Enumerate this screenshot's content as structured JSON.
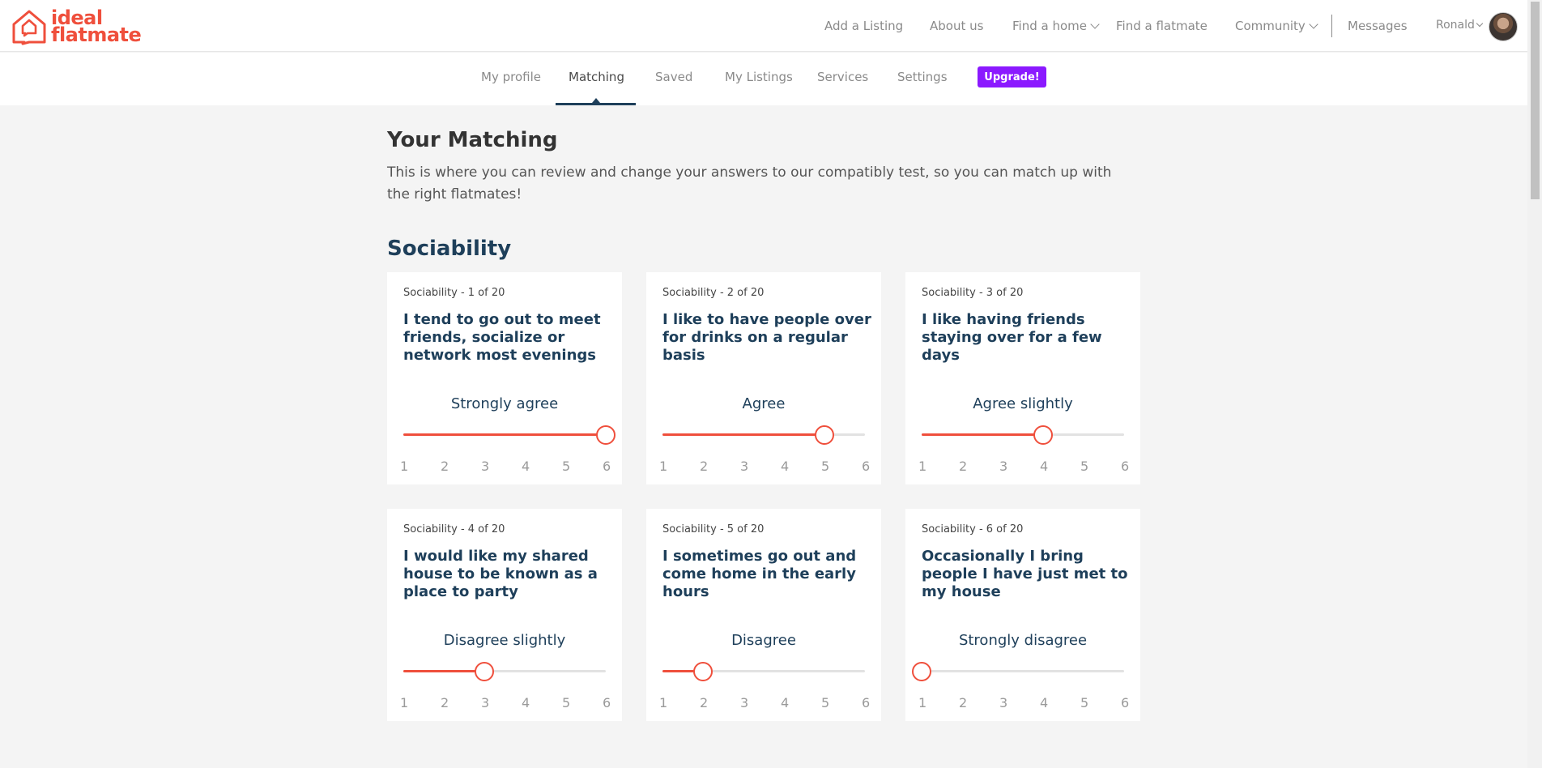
{
  "brand": {
    "line1": "ideal",
    "line2": "flatmate",
    "color": "#ef4f3c"
  },
  "topnav": {
    "add_listing": "Add a Listing",
    "about": "About us",
    "find_home": "Find a home",
    "find_flatmate": "Find a flatmate",
    "community": "Community",
    "messages": "Messages",
    "user": "Ronald"
  },
  "subnav": {
    "tabs": [
      "My profile",
      "Matching",
      "Saved",
      "My Listings",
      "Services",
      "Settings"
    ],
    "active": "Matching",
    "upgrade": "Upgrade!",
    "upgrade_color": "#8b19ff"
  },
  "page": {
    "title": "Your Matching",
    "intro": "This is where you can review and change your answers to our compatibly test, so you can match up with the right flatmates!"
  },
  "section": {
    "title": "Sociability"
  },
  "scale_labels": [
    "1",
    "2",
    "3",
    "4",
    "5",
    "6"
  ],
  "questions": [
    {
      "counter": "Sociability - 1 of 20",
      "text": "I tend to go out to meet friends, socialize or network most evenings",
      "answer": "Strongly agree",
      "value": 6
    },
    {
      "counter": "Sociability - 2 of 20",
      "text": "I like to have people over for drinks on a regular basis",
      "answer": "Agree",
      "value": 5
    },
    {
      "counter": "Sociability - 3 of 20",
      "text": "I like having friends staying over for a few days",
      "answer": "Agree slightly",
      "value": 4
    },
    {
      "counter": "Sociability - 4 of 20",
      "text": "I would like my shared house to be known as a place to party",
      "answer": "Disagree slightly",
      "value": 3
    },
    {
      "counter": "Sociability - 5 of 20",
      "text": "I sometimes go out and come home in the early hours",
      "answer": "Disagree",
      "value": 2
    },
    {
      "counter": "Sociability - 6 of 20",
      "text": "Occasionally I bring people I have just met to my house",
      "answer": "Strongly disagree",
      "value": 1
    }
  ],
  "colors": {
    "accent": "#ef4f3c",
    "navy": "#1e3f5a"
  }
}
